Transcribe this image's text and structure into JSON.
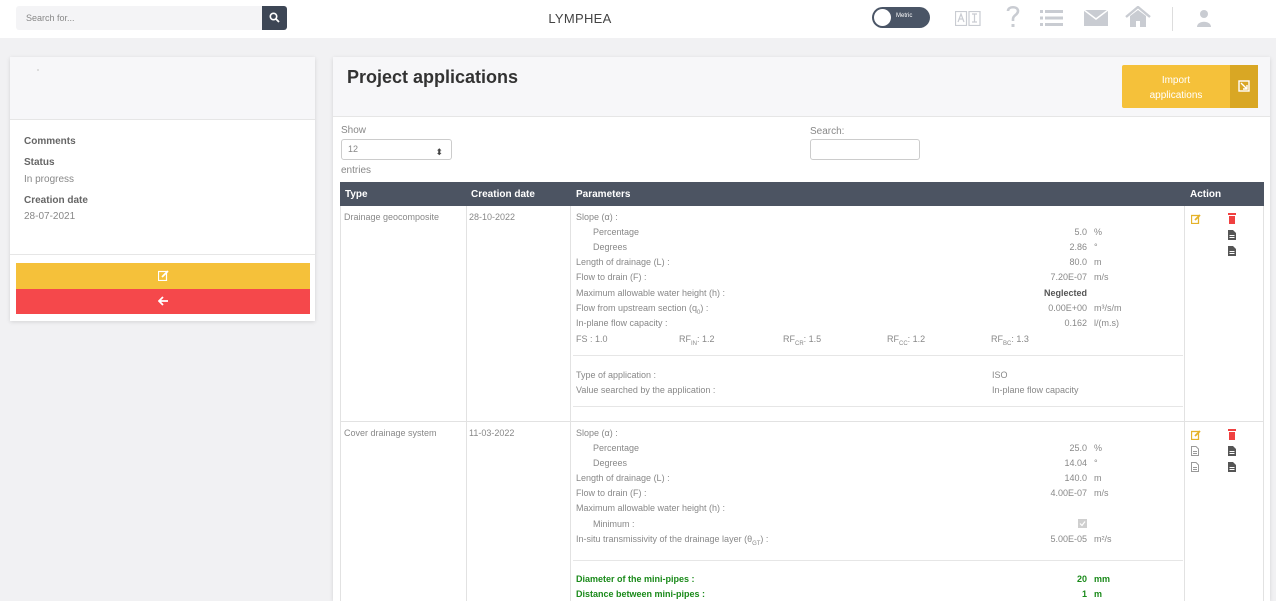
{
  "topbar": {
    "search_placeholder": "Search for...",
    "app_title": "LYMPHEA",
    "unit_toggle_label": "Metric"
  },
  "project": {
    "comments_label": "Comments",
    "status_label": "Status",
    "status_value": "In progress",
    "creation_date_label": "Creation date",
    "creation_date_value": "28-07-2021"
  },
  "main": {
    "title": "Project applications",
    "import_label_line1": "Import",
    "import_label_line2": "applications",
    "show_label": "Show",
    "entries_value": "12",
    "entries_label": "entries",
    "search_label": "Search:"
  },
  "table": {
    "headers": {
      "type": "Type",
      "creation_date": "Creation date",
      "parameters": "Parameters",
      "action": "Action"
    },
    "row1": {
      "type": "Drainage geocomposite",
      "date": "28-10-2022",
      "slope_label": "Slope (α) :",
      "percentage_label": "Percentage",
      "percentage_value": "5.0",
      "percentage_unit": "%",
      "degrees_label": "Degrees",
      "degrees_value": "2.86",
      "degrees_unit": "°",
      "length_label": "Length of drainage (L) :",
      "length_value": "80.0",
      "length_unit": "m",
      "flow_label": "Flow to drain (F) :",
      "flow_value": "7.20E-07",
      "flow_unit": "m/s",
      "max_height_label": "Maximum allowable water height (h) :",
      "max_height_value": "Neglected",
      "upstream_label": "Flow from upstream section (q",
      "upstream_sub": "0",
      "upstream_label_end": ") :",
      "upstream_value": "0.00E+00",
      "upstream_unit": "m³/s/m",
      "inplane_label": "In-plane flow capacity :",
      "inplane_value": "0.162",
      "inplane_unit": "l/(m.s)",
      "fs": "FS : 1.0",
      "rfin_prefix": "RF",
      "rfin_sub": "IN",
      "rfin_val": ": 1.2",
      "rfcr_prefix": "RF",
      "rfcr_sub": "CR",
      "rfcr_val": ": 1.5",
      "rfcc_prefix": "RF",
      "rfcc_sub": "CC",
      "rfcc_val": ": 1.2",
      "rfbc_prefix": "RF",
      "rfbc_sub": "BC",
      "rfbc_val": ": 1.3",
      "app_type_label": "Type of application :",
      "app_type_value": "ISO",
      "searched_label": "Value searched by the application :",
      "searched_value": "In-plane flow capacity"
    },
    "row2": {
      "type": "Cover drainage system",
      "date": "11-03-2022",
      "slope_label": "Slope (α) :",
      "percentage_label": "Percentage",
      "percentage_value": "25.0",
      "percentage_unit": "%",
      "degrees_label": "Degrees",
      "degrees_value": "14.04",
      "degrees_unit": "°",
      "length_label": "Length of drainage (L) :",
      "length_value": "140.0",
      "length_unit": "m",
      "flow_label": "Flow to drain (F) :",
      "flow_value": "4.00E-07",
      "flow_unit": "m/s",
      "max_height_label": "Maximum allowable water height (h) :",
      "minimum_label": "Minimum :",
      "transmissivity_label": "In-situ transmissivity of the drainage layer (θ",
      "transmissivity_sub": "GT",
      "transmissivity_label_end": ") :",
      "transmissivity_value": "5.00E-05",
      "transmissivity_unit": "m²/s",
      "diameter_label": "Diameter of the mini-pipes :",
      "diameter_value": "20",
      "diameter_unit": "mm",
      "distance_label": "Distance between mini-pipes :",
      "distance_value": "1",
      "distance_unit": "m"
    }
  },
  "colors": {
    "accent_yellow": "#f5c13a",
    "danger_red": "#f5484b",
    "header_dark": "#4c5462",
    "ok_green": "#1a8a1a"
  },
  "icons": [
    "search-icon",
    "toggle-icon",
    "dictionary-icon",
    "help-icon",
    "list-icon",
    "mail-icon",
    "home-icon",
    "user-icon",
    "edit-icon",
    "back-arrow-icon",
    "import-icon",
    "delete-icon",
    "document-icon"
  ]
}
